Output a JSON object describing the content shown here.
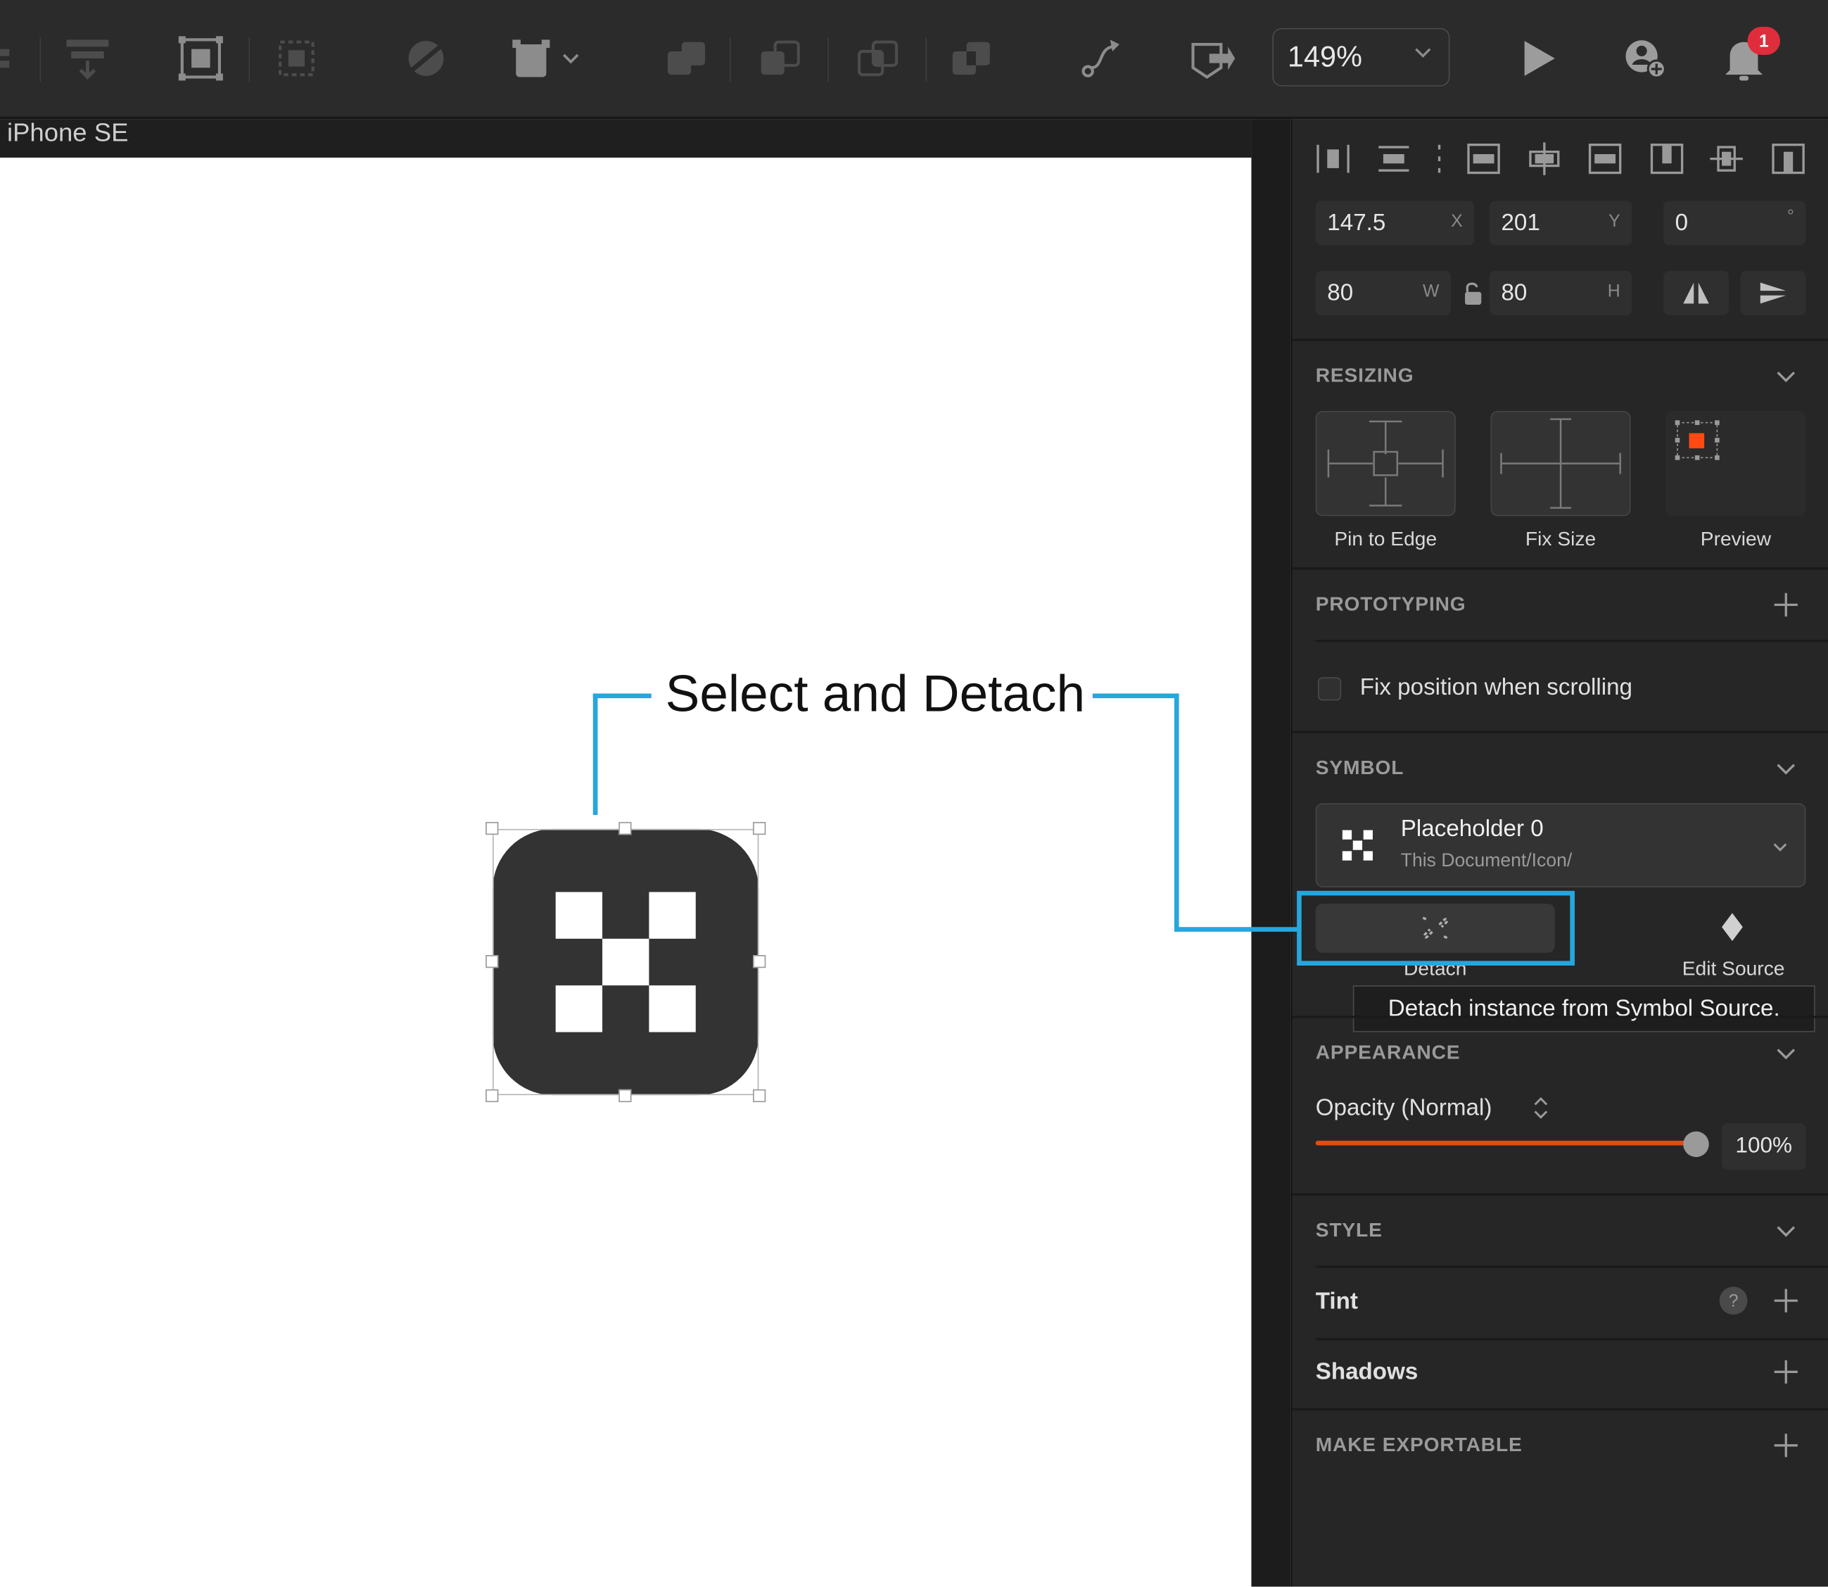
{
  "toolbar": {
    "zoom": "149%",
    "notification_count": "1",
    "icons": [
      "insert-icon",
      "group-icon",
      "ungroup-icon",
      "mask-icon",
      "transform-icon",
      "union-icon",
      "subtract-icon",
      "intersect-icon",
      "difference-icon",
      "edit-path-icon",
      "preview-share-icon",
      "zoom-dropdown",
      "play-icon",
      "add-user-icon",
      "bell-icon"
    ]
  },
  "canvas": {
    "artboard_label": "iPhone SE",
    "annotation": "Select and Detach",
    "annotation_color": "#27a6dd"
  },
  "inspector": {
    "position": {
      "x": "147.5",
      "x_unit": "X",
      "y": "201",
      "y_unit": "Y",
      "rotation": "0",
      "rotation_unit": "°",
      "w": "80",
      "w_unit": "W",
      "h": "80",
      "h_unit": "H"
    },
    "resizing": {
      "title": "RESIZING",
      "pin_to_edge": "Pin to Edge",
      "fix_size": "Fix Size",
      "preview": "Preview"
    },
    "prototyping": {
      "title": "PROTOTYPING",
      "fix_position": "Fix position when scrolling",
      "fix_position_checked": false
    },
    "symbol": {
      "title": "SYMBOL",
      "name": "Placeholder 0",
      "path": "This Document/Icon/",
      "detach_label": "Detach",
      "edit_source_label": "Edit Source",
      "tooltip": "Detach instance from Symbol Source."
    },
    "appearance": {
      "title": "APPEARANCE",
      "opacity_label": "Opacity (Normal)",
      "opacity_value": "100%",
      "opacity_fraction": 1.0,
      "accent": "#e04b16"
    },
    "style": {
      "title": "STYLE",
      "tint": "Tint",
      "shadows": "Shadows"
    },
    "export": {
      "title": "MAKE EXPORTABLE"
    }
  }
}
